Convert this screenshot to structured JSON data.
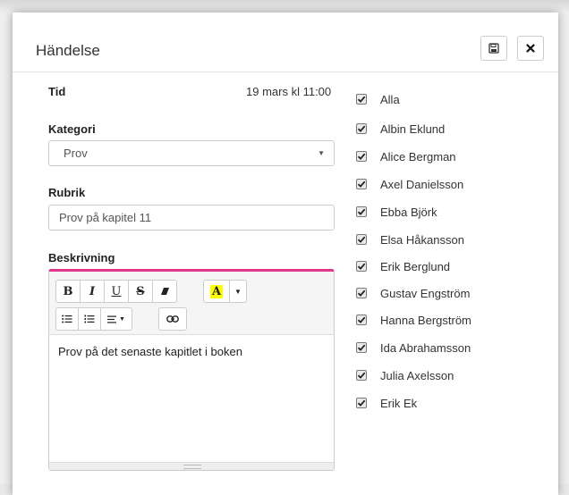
{
  "modal": {
    "title": "Händelse",
    "save_icon": "save-icon",
    "close_icon": "close-icon"
  },
  "tid": {
    "label": "Tid",
    "value": "19 mars kl 11:00"
  },
  "kategori": {
    "label": "Kategori",
    "selected": "Prov"
  },
  "rubrik": {
    "label": "Rubrik",
    "value": "Prov på kapitel 11"
  },
  "beskrivning": {
    "label": "Beskrivning",
    "content": "Prov på det senaste kapitlet i boken",
    "toolbar": {
      "bold": "B",
      "italic": "I",
      "underline": "U",
      "strike": "S",
      "highlight": "A"
    },
    "accent_color": "#e0378d"
  },
  "participants": [
    {
      "name": "Alla",
      "checked": true
    },
    {
      "name": "Albin Eklund",
      "checked": true
    },
    {
      "name": "Alice Bergman",
      "checked": true
    },
    {
      "name": "Axel Danielsson",
      "checked": true
    },
    {
      "name": "Ebba Björk",
      "checked": true
    },
    {
      "name": "Elsa Håkansson",
      "checked": true
    },
    {
      "name": "Erik Berglund",
      "checked": true
    },
    {
      "name": "Gustav Engström",
      "checked": true
    },
    {
      "name": "Hanna Bergström",
      "checked": true
    },
    {
      "name": "Ida Abrahamsson",
      "checked": true
    },
    {
      "name": "Julia Axelsson",
      "checked": true
    },
    {
      "name": "Erik Ek",
      "checked": true
    }
  ]
}
